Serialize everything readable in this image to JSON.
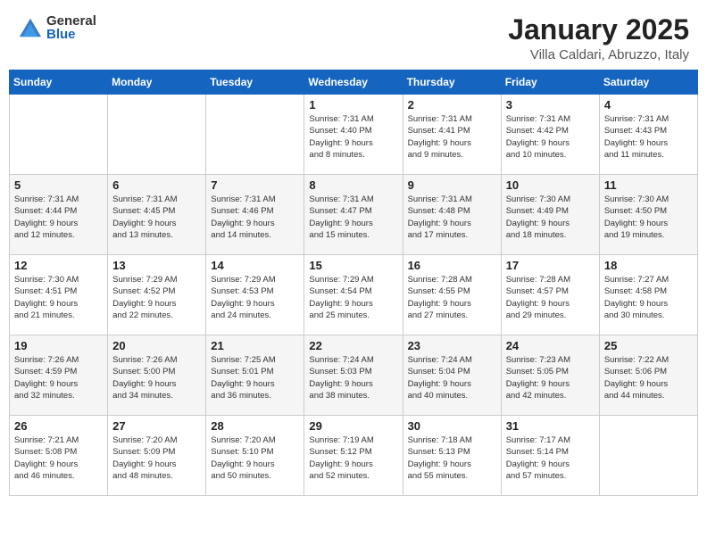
{
  "logo": {
    "general": "General",
    "blue": "Blue"
  },
  "title": "January 2025",
  "location": "Villa Caldari, Abruzzo, Italy",
  "days_header": [
    "Sunday",
    "Monday",
    "Tuesday",
    "Wednesday",
    "Thursday",
    "Friday",
    "Saturday"
  ],
  "weeks": [
    [
      {
        "day": "",
        "info": ""
      },
      {
        "day": "",
        "info": ""
      },
      {
        "day": "",
        "info": ""
      },
      {
        "day": "1",
        "info": "Sunrise: 7:31 AM\nSunset: 4:40 PM\nDaylight: 9 hours\nand 8 minutes."
      },
      {
        "day": "2",
        "info": "Sunrise: 7:31 AM\nSunset: 4:41 PM\nDaylight: 9 hours\nand 9 minutes."
      },
      {
        "day": "3",
        "info": "Sunrise: 7:31 AM\nSunset: 4:42 PM\nDaylight: 9 hours\nand 10 minutes."
      },
      {
        "day": "4",
        "info": "Sunrise: 7:31 AM\nSunset: 4:43 PM\nDaylight: 9 hours\nand 11 minutes."
      }
    ],
    [
      {
        "day": "5",
        "info": "Sunrise: 7:31 AM\nSunset: 4:44 PM\nDaylight: 9 hours\nand 12 minutes."
      },
      {
        "day": "6",
        "info": "Sunrise: 7:31 AM\nSunset: 4:45 PM\nDaylight: 9 hours\nand 13 minutes."
      },
      {
        "day": "7",
        "info": "Sunrise: 7:31 AM\nSunset: 4:46 PM\nDaylight: 9 hours\nand 14 minutes."
      },
      {
        "day": "8",
        "info": "Sunrise: 7:31 AM\nSunset: 4:47 PM\nDaylight: 9 hours\nand 15 minutes."
      },
      {
        "day": "9",
        "info": "Sunrise: 7:31 AM\nSunset: 4:48 PM\nDaylight: 9 hours\nand 17 minutes."
      },
      {
        "day": "10",
        "info": "Sunrise: 7:30 AM\nSunset: 4:49 PM\nDaylight: 9 hours\nand 18 minutes."
      },
      {
        "day": "11",
        "info": "Sunrise: 7:30 AM\nSunset: 4:50 PM\nDaylight: 9 hours\nand 19 minutes."
      }
    ],
    [
      {
        "day": "12",
        "info": "Sunrise: 7:30 AM\nSunset: 4:51 PM\nDaylight: 9 hours\nand 21 minutes."
      },
      {
        "day": "13",
        "info": "Sunrise: 7:29 AM\nSunset: 4:52 PM\nDaylight: 9 hours\nand 22 minutes."
      },
      {
        "day": "14",
        "info": "Sunrise: 7:29 AM\nSunset: 4:53 PM\nDaylight: 9 hours\nand 24 minutes."
      },
      {
        "day": "15",
        "info": "Sunrise: 7:29 AM\nSunset: 4:54 PM\nDaylight: 9 hours\nand 25 minutes."
      },
      {
        "day": "16",
        "info": "Sunrise: 7:28 AM\nSunset: 4:55 PM\nDaylight: 9 hours\nand 27 minutes."
      },
      {
        "day": "17",
        "info": "Sunrise: 7:28 AM\nSunset: 4:57 PM\nDaylight: 9 hours\nand 29 minutes."
      },
      {
        "day": "18",
        "info": "Sunrise: 7:27 AM\nSunset: 4:58 PM\nDaylight: 9 hours\nand 30 minutes."
      }
    ],
    [
      {
        "day": "19",
        "info": "Sunrise: 7:26 AM\nSunset: 4:59 PM\nDaylight: 9 hours\nand 32 minutes."
      },
      {
        "day": "20",
        "info": "Sunrise: 7:26 AM\nSunset: 5:00 PM\nDaylight: 9 hours\nand 34 minutes."
      },
      {
        "day": "21",
        "info": "Sunrise: 7:25 AM\nSunset: 5:01 PM\nDaylight: 9 hours\nand 36 minutes."
      },
      {
        "day": "22",
        "info": "Sunrise: 7:24 AM\nSunset: 5:03 PM\nDaylight: 9 hours\nand 38 minutes."
      },
      {
        "day": "23",
        "info": "Sunrise: 7:24 AM\nSunset: 5:04 PM\nDaylight: 9 hours\nand 40 minutes."
      },
      {
        "day": "24",
        "info": "Sunrise: 7:23 AM\nSunset: 5:05 PM\nDaylight: 9 hours\nand 42 minutes."
      },
      {
        "day": "25",
        "info": "Sunrise: 7:22 AM\nSunset: 5:06 PM\nDaylight: 9 hours\nand 44 minutes."
      }
    ],
    [
      {
        "day": "26",
        "info": "Sunrise: 7:21 AM\nSunset: 5:08 PM\nDaylight: 9 hours\nand 46 minutes."
      },
      {
        "day": "27",
        "info": "Sunrise: 7:20 AM\nSunset: 5:09 PM\nDaylight: 9 hours\nand 48 minutes."
      },
      {
        "day": "28",
        "info": "Sunrise: 7:20 AM\nSunset: 5:10 PM\nDaylight: 9 hours\nand 50 minutes."
      },
      {
        "day": "29",
        "info": "Sunrise: 7:19 AM\nSunset: 5:12 PM\nDaylight: 9 hours\nand 52 minutes."
      },
      {
        "day": "30",
        "info": "Sunrise: 7:18 AM\nSunset: 5:13 PM\nDaylight: 9 hours\nand 55 minutes."
      },
      {
        "day": "31",
        "info": "Sunrise: 7:17 AM\nSunset: 5:14 PM\nDaylight: 9 hours\nand 57 minutes."
      },
      {
        "day": "",
        "info": ""
      }
    ]
  ]
}
